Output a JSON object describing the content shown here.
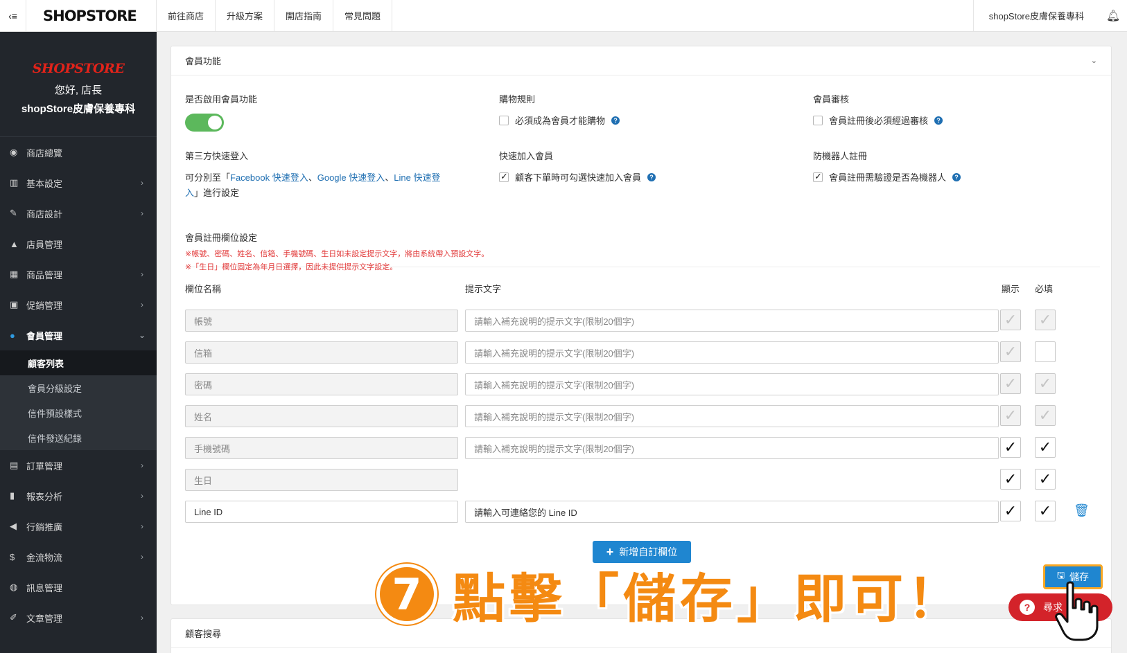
{
  "topbar": {
    "brand": "SHOPSTORE",
    "nav": [
      "前往商店",
      "升級方案",
      "開店指南",
      "常見問題"
    ],
    "store_name": "shopStore皮膚保養專科"
  },
  "sidebar": {
    "logo": "SHOPSTORE",
    "greeting": "您好, 店長",
    "store": "shopStore皮膚保養專科",
    "items": [
      {
        "icon": "◉",
        "label": "商店總覽",
        "arrow": ""
      },
      {
        "icon": "▥",
        "label": "基本設定",
        "arrow": "›"
      },
      {
        "icon": "✎",
        "label": "商店設計",
        "arrow": "›"
      },
      {
        "icon": "▲",
        "label": "店員管理",
        "arrow": ""
      },
      {
        "icon": "▦",
        "label": "商品管理",
        "arrow": "›"
      },
      {
        "icon": "▣",
        "label": "促銷管理",
        "arrow": "›"
      },
      {
        "icon": "●",
        "label": "會員管理",
        "arrow": "⌄"
      }
    ],
    "sub_items": [
      "顧客列表",
      "會員分級設定",
      "信件預設樣式",
      "信件發送紀錄"
    ],
    "items2": [
      {
        "icon": "▤",
        "label": "訂單管理",
        "arrow": "›"
      },
      {
        "icon": "▮",
        "label": "報表分析",
        "arrow": "›"
      },
      {
        "icon": "◀",
        "label": "行銷推廣",
        "arrow": "›"
      },
      {
        "icon": "$",
        "label": "金流物流",
        "arrow": "›"
      },
      {
        "icon": "◍",
        "label": "訊息管理",
        "arrow": ""
      },
      {
        "icon": "✐",
        "label": "文章管理",
        "arrow": "›"
      }
    ]
  },
  "panel": {
    "title": "會員功能",
    "enable_label": "是否啟用會員功能",
    "shopping_rules": "購物規則",
    "shopping_rules_opt": "必須成為會員才能購物",
    "member_review": "會員審核",
    "member_review_opt": "會員註冊後必須經過審核",
    "third_party": "第三方快速登入",
    "third_party_desc_1": "可分別至「",
    "third_party_link_1": "Facebook 快速登入",
    "third_party_sep_1": "、",
    "third_party_link_2": "Google 快速登入",
    "third_party_sep_2": "、",
    "third_party_link_3a": "Line 快速登",
    "third_party_link_3b": "入",
    "third_party_desc_2": "」進行設定",
    "quick_join": "快速加入會員",
    "quick_join_opt": "顧客下單時可勾選快速加入會員",
    "anti_bot": "防機器人註冊",
    "anti_bot_opt": "會員註冊需驗證是否為機器人",
    "reg_title": "會員註冊欄位設定",
    "note1": "※帳號、密碼、姓名、信箱、手機號碼、生日如未設定提示文字，將由系統帶入預設文字。",
    "note2": "※「生日」欄位固定為年月日選擇，因此未提供提示文字設定。",
    "col_name": "欄位名稱",
    "col_hint": "提示文字",
    "col_show": "顯示",
    "col_required": "必填",
    "hint_placeholder": "請輸入補充說明的提示文字(限制20個字)",
    "rows": [
      {
        "name": "帳號",
        "hint": "請輸入補充說明的提示文字(限制20個字)"
      },
      {
        "name": "信箱",
        "hint": "請輸入補充說明的提示文字(限制20個字)"
      },
      {
        "name": "密碼",
        "hint": "請輸入補充說明的提示文字(限制20個字)"
      },
      {
        "name": "姓名",
        "hint": "請輸入補充說明的提示文字(限制20個字)"
      },
      {
        "name": "手機號碼",
        "hint": "請輸入補充說明的提示文字(限制20個字)"
      },
      {
        "name": "生日",
        "hint": ""
      },
      {
        "name": "Line ID",
        "hint": "請輸入可連絡您的 Line ID"
      }
    ],
    "add_button": "新增自訂欄位",
    "save_button": "儲存"
  },
  "help_fab": "尋求",
  "annotation": {
    "number": "7",
    "text": "點擊「儲存」即可！"
  },
  "panel2": {
    "title": "顧客搜尋"
  }
}
